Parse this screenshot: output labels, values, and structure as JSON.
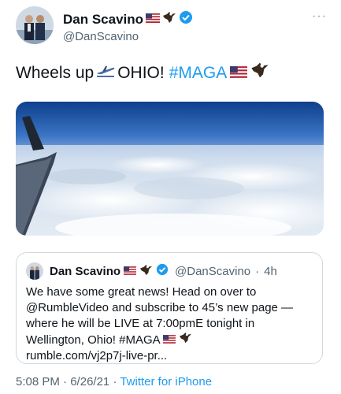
{
  "author": {
    "display_name": "Dan Scavino",
    "handle": "@DanScavino",
    "badges": [
      "us-flag-emoji",
      "eagle-emoji",
      "verified-badge"
    ]
  },
  "more_menu": {
    "label": "···"
  },
  "tweet": {
    "text_part1": "Wheels up",
    "text_part2": "OHIO!",
    "hashtag": "#MAGA",
    "inline_emojis": [
      "airplane-departure-emoji",
      "us-flag-emoji",
      "eagle-emoji"
    ]
  },
  "media": {
    "subject": "view of clouds from airplane window with wing"
  },
  "quoted_tweet": {
    "display_name": "Dan Scavino",
    "handle": "@DanScavino",
    "separator": "·",
    "time": "4h",
    "lines": [
      "We have some great news! Head on over to",
      "@RumbleVideo and subscribe to 45’s new page —",
      "where he will be LIVE at 7:00pmE tonight in",
      "Wellington, Ohio! #MAGA",
      "rumble.com/vj2p7j-live-pr..."
    ]
  },
  "footer": {
    "time": "5:08 PM",
    "separator1": "·",
    "date": "6/26/21",
    "separator2": "·",
    "source": "Twitter for iPhone"
  },
  "colors": {
    "link": "#1d9bf0",
    "secondary_text": "#536471",
    "border": "#cfd9de"
  }
}
